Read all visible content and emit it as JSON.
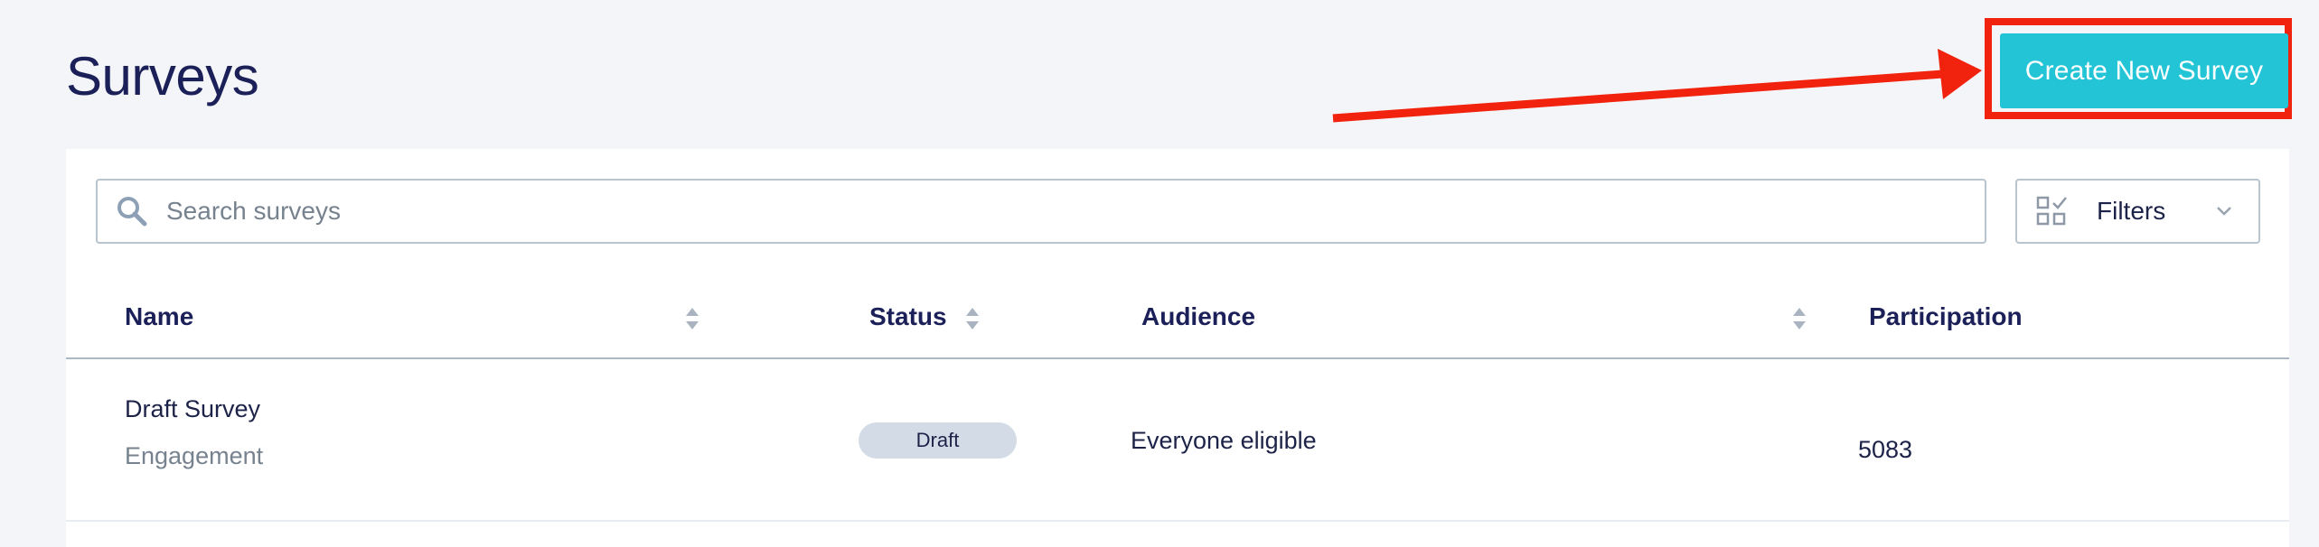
{
  "page": {
    "title": "Surveys"
  },
  "actions": {
    "create_label": "Create New Survey"
  },
  "annotation": {
    "color": "#f2230e"
  },
  "search": {
    "placeholder": "Search surveys"
  },
  "filters": {
    "label": "Filters"
  },
  "table": {
    "columns": [
      {
        "label": "Name",
        "sortable": true
      },
      {
        "label": "Status",
        "sortable": true
      },
      {
        "label": "Audience",
        "sortable": true
      },
      {
        "label": "Participation",
        "sortable": false
      }
    ],
    "rows": [
      {
        "name": "Draft Survey",
        "type": "Engagement",
        "status": "Draft",
        "audience": "Everyone eligible",
        "participation": "5083"
      }
    ]
  },
  "colors": {
    "accent": "#22c4d6",
    "title": "#1b2059",
    "background": "#f4f5f9",
    "badge": "#d2dbe6"
  }
}
